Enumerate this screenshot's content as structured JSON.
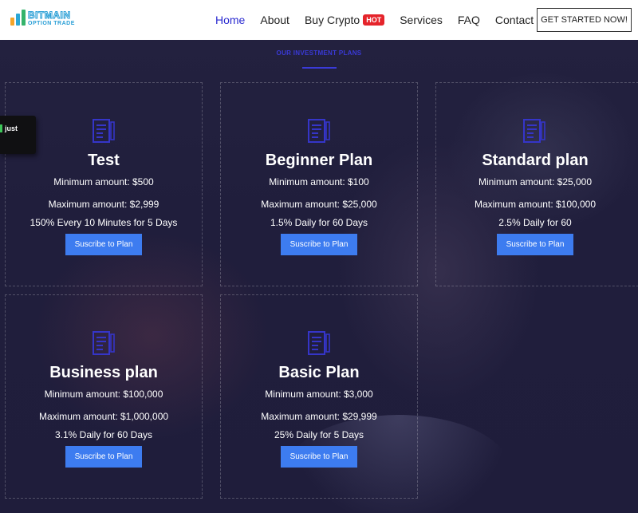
{
  "header": {
    "logo": {
      "line1": "BITMAIN",
      "line2": "OPTION TRADE"
    },
    "nav": [
      {
        "label": "Home",
        "active": true
      },
      {
        "label": "About"
      },
      {
        "label": "Buy Crypto",
        "badge": "HOT"
      },
      {
        "label": "Services"
      },
      {
        "label": "FAQ"
      },
      {
        "label": "Contact"
      }
    ],
    "cta": "GET STARTED NOW!"
  },
  "section": {
    "label": "OUR INVESTMENT PLANS"
  },
  "toast": {
    "text": "just"
  },
  "plans": [
    {
      "name": "Test",
      "min": "Minimum amount: $500",
      "max": "Maximum amount: $2,999",
      "rate": "150% Every 10 Minutes for 5 Days",
      "button": "Suscribe to Plan"
    },
    {
      "name": "Beginner Plan",
      "min": "Minimum amount: $100",
      "max": "Maximum amount: $25,000",
      "rate": "1.5% Daily for 60 Days",
      "button": "Suscribe to Plan"
    },
    {
      "name": "Standard plan",
      "min": "Minimum amount: $25,000",
      "max": "Maximum amount: $100,000",
      "rate": "2.5% Daily for 60",
      "button": "Suscribe to Plan"
    },
    {
      "name": "Business plan",
      "min": "Minimum amount: $100,000",
      "max": "Maximum amount: $1,000,000",
      "rate": "3.1% Daily for 60 Days",
      "button": "Suscribe to Plan"
    },
    {
      "name": "Basic Plan",
      "min": "Minimum amount: $3,000",
      "max": "Maximum amount: $29,999",
      "rate": "25% Daily for 5 Days",
      "button": "Suscribe to Plan"
    }
  ],
  "colors": {
    "accent": "#3a3ad8",
    "button": "#3d7cf0",
    "hot": "#e5242b",
    "background": "#1f1d3b"
  },
  "icons": {
    "plan": "document-icon"
  }
}
